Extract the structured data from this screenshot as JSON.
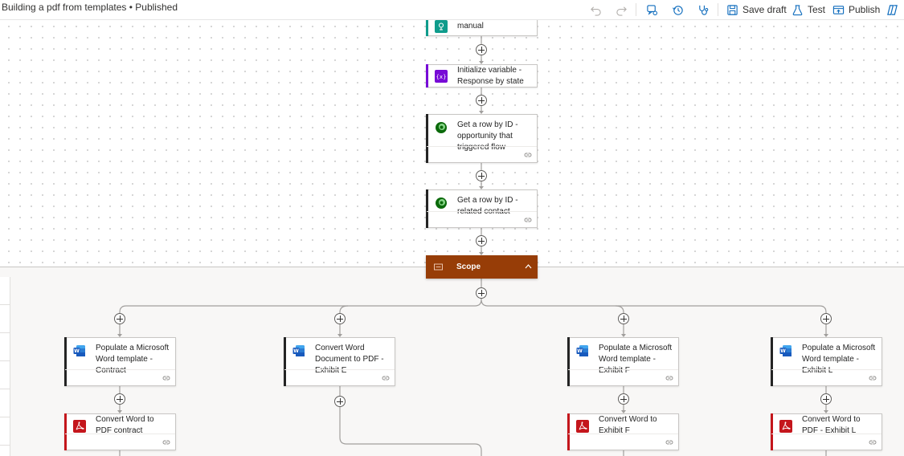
{
  "topbar": {
    "title": "Building a pdf from templates • Published",
    "save_draft": "Save draft",
    "test": "Test",
    "publish": "Publish"
  },
  "steps": {
    "manual": {
      "title": "manual",
      "icon": "trigger-icon",
      "color": "#0f9c8c"
    },
    "init_var": {
      "title": "Initialize variable - Response by state",
      "icon": "variable-icon",
      "color": "#770bd6"
    },
    "get_row_1": {
      "title": "Get a row by ID - opportunity that triggered flow",
      "icon": "dataverse-icon",
      "color": "#242424"
    },
    "get_row_2": {
      "title": "Get a row by ID - related contact",
      "icon": "dataverse-icon",
      "color": "#242424"
    },
    "scope": {
      "title": "Scope",
      "icon": "scope-icon",
      "color": "#973d07"
    },
    "populate_contract": {
      "title": "Populate a Microsoft Word template - Contract",
      "icon": "word-icon"
    },
    "convert_exhibit_e": {
      "title": "Convert Word Document to PDF - Exhibit E",
      "icon": "word-icon"
    },
    "populate_exhibit_f": {
      "title": "Populate a Microsoft Word template - Exhibit F",
      "icon": "word-icon"
    },
    "populate_exhibit_l": {
      "title": "Populate a Microsoft Word template - Exhibit L",
      "icon": "word-icon"
    },
    "convert_contract": {
      "title": "Convert Word to PDF contract",
      "icon": "pdf-icon",
      "color": "#c4161c"
    },
    "convert_exhibit_f": {
      "title": "Convert Word to Exhibit F",
      "icon": "pdf-icon",
      "color": "#c4161c"
    },
    "convert_exhibit_l": {
      "title": "Convert Word to PDF - Exhibit L",
      "icon": "pdf-icon",
      "color": "#c4161c"
    }
  }
}
